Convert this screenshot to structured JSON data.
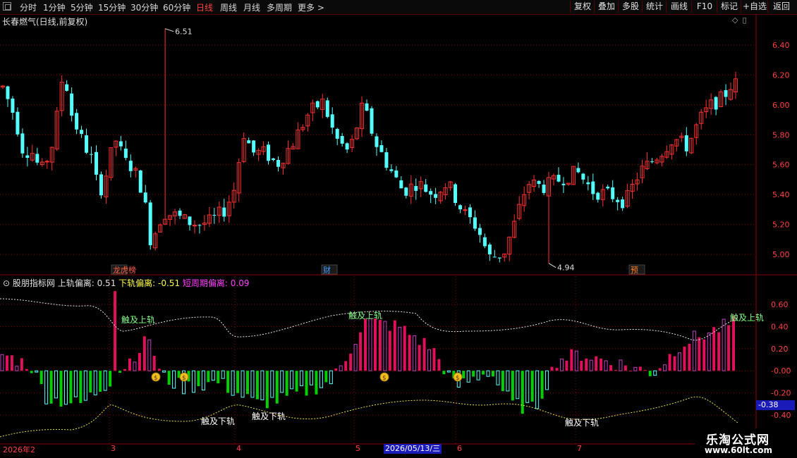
{
  "toolbar": {
    "periods": [
      "分时",
      "1分钟",
      "5分钟",
      "15分钟",
      "30分钟",
      "60分钟",
      "日线",
      "周线",
      "月线",
      "多周期",
      "更多 >"
    ],
    "active_period": "日线",
    "right_buttons": [
      "复权",
      "叠加",
      "多股",
      "统计",
      "画线",
      "F10",
      "标记",
      "+自选",
      "返回"
    ]
  },
  "stock": {
    "title": "长春燃气(日线,前复权)",
    "high_label": "6.51",
    "low_label": "4.94"
  },
  "price_axis": [
    "6.40",
    "6.20",
    "6.00",
    "5.80",
    "5.60",
    "5.40",
    "5.20",
    "5.00"
  ],
  "events": [
    "龙虎榜",
    "财",
    "预"
  ],
  "indicator": {
    "name": "股朋指标网",
    "upper_label": "上轨偏离:",
    "upper_value": "0.51",
    "lower_label": "下轨偏离:",
    "lower_value": "-0.51",
    "short_label": "短周期偏离:",
    "short_value": "0.09",
    "axis": [
      "0.60",
      "0.40",
      "0.20",
      "-0.00",
      "-0.20",
      "-0.40"
    ],
    "current_value": "-0.38",
    "annotations": {
      "touch_upper": "触及上轨",
      "touch_lower": "触及下轨"
    }
  },
  "dates": {
    "labels": [
      "2026年2",
      "3",
      "4",
      "5",
      "6",
      "7"
    ],
    "cursor": "2026/05/13/三"
  },
  "watermark": {
    "name": "乐淘公式网",
    "url": "www.60lt.com"
  },
  "colors": {
    "up": "#ff3030",
    "down": "#54ffff",
    "green": "#00d000",
    "magenta": "#c040c0",
    "crimson": "#e0105a",
    "grid": "#8b0000"
  }
}
